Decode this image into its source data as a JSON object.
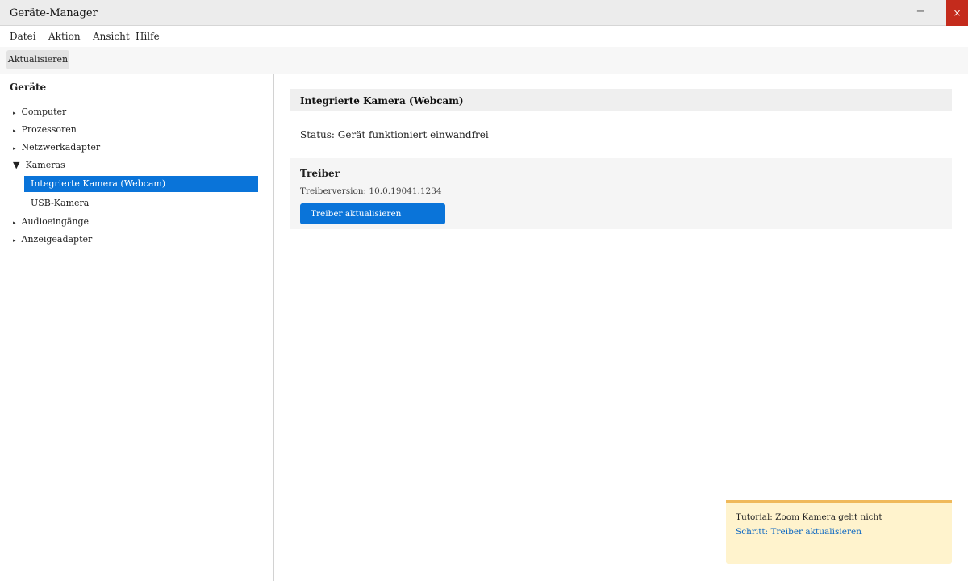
{
  "window": {
    "title": "Geräte-Manager",
    "minimize_glyph": "−",
    "close_glyph": "×"
  },
  "menu": [
    "Datei",
    "Aktion",
    "Ansicht",
    "Hilfe"
  ],
  "toolbar": {
    "refresh_label": "Aktualisieren"
  },
  "sidebar": {
    "heading": "Geräte",
    "categories": [
      {
        "label": "Computer",
        "expanded": false
      },
      {
        "label": "Prozessoren",
        "expanded": false
      },
      {
        "label": "Netzwerkadapter",
        "expanded": false
      },
      {
        "label": "Kameras",
        "expanded": true,
        "children": [
          {
            "label": "Integrierte Kamera (Webcam)",
            "selected": true
          },
          {
            "label": "USB-Kamera",
            "selected": false
          }
        ]
      },
      {
        "label": "Audioeingänge",
        "expanded": false
      },
      {
        "label": "Anzeigeadapter",
        "expanded": false
      }
    ],
    "collapsed_arrow": "▸",
    "expanded_arrow": "▼"
  },
  "details": {
    "device_name": "Integrierte Kamera (Webcam)",
    "status": "Status: Gerät funktioniert einwandfrei",
    "driver": {
      "title": "Treiber",
      "version": "Treiberversion: 10.0.19041.1234",
      "update_button": "Treiber aktualisieren"
    }
  },
  "tutorial": {
    "title": "Tutorial: Zoom Kamera geht nicht",
    "step": "Schritt: Treiber aktualisieren"
  },
  "colors": {
    "accent": "#0a74d9",
    "close_button": "#c42b1c",
    "tutorial_bg": "#fff3cd",
    "tutorial_border": "#f0b95a"
  }
}
